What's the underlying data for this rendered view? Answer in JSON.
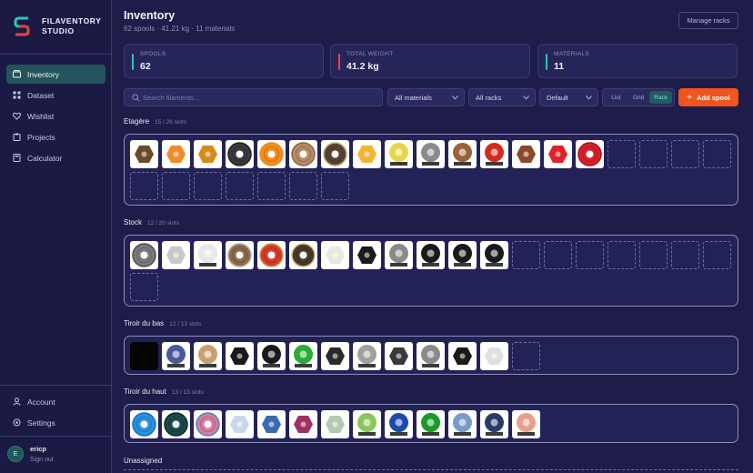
{
  "brand": {
    "line1": "FILAVENTORY",
    "line2": "STUDIO",
    "logo_icon": "filaventory-logo-icon"
  },
  "nav": [
    {
      "label": "Inventory",
      "icon": "box-icon",
      "active": true
    },
    {
      "label": "Dataset",
      "icon": "grid-icon",
      "active": false
    },
    {
      "label": "Wishlist",
      "icon": "heart-icon",
      "active": false
    },
    {
      "label": "Projects",
      "icon": "clipboard-icon",
      "active": false
    },
    {
      "label": "Calculator",
      "icon": "calculator-icon",
      "active": false
    }
  ],
  "nav_bottom": [
    {
      "label": "Account",
      "icon": "user-icon"
    },
    {
      "label": "Settings",
      "icon": "gear-icon"
    }
  ],
  "user": {
    "initial": "E",
    "name": "ericp",
    "sign_out": "Sign out"
  },
  "header": {
    "title": "Inventory",
    "subtitle": "62 spools · 41.21 kg · 11 materials",
    "manage_label": "Manage racks"
  },
  "stats": [
    {
      "label": "SPOOLS",
      "value": "62",
      "color": "#2ec4b6"
    },
    {
      "label": "TOTAL WEIGHT",
      "value": "41.2 kg",
      "color": "#e8453c"
    },
    {
      "label": "MATERIALS",
      "value": "11",
      "color": "#2ec4b6"
    }
  ],
  "toolbar": {
    "search_placeholder": "Search filaments...",
    "materials": "All materials",
    "racks": "All racks",
    "sort": "Default",
    "views": [
      "List",
      "Grid",
      "Rack"
    ],
    "active_view": "Rack",
    "add_label": "Add spool"
  },
  "racks": [
    {
      "name": "Etagère",
      "count": "15 / 26 slots",
      "spools": [
        {
          "kind": "sample",
          "color": "#6b4a2a"
        },
        {
          "kind": "sample",
          "color": "#f08a2a"
        },
        {
          "kind": "sample",
          "color": "#d98a1e"
        },
        {
          "kind": "spool",
          "color": "#3a3a3a",
          "ring": "#222222"
        },
        {
          "kind": "spool",
          "color": "#f28c1a",
          "ring": "#f28c1a"
        },
        {
          "kind": "spool",
          "color": "#b58a66",
          "ring": "#8a6a4a"
        },
        {
          "kind": "spool",
          "color": "#5a4330",
          "ring": "#c0b090"
        },
        {
          "kind": "sample",
          "color": "#f2b531"
        },
        {
          "kind": "bag",
          "color": "#e8d64a"
        },
        {
          "kind": "bag",
          "color": "#8a8a8a"
        },
        {
          "kind": "bag",
          "color": "#9a6238"
        },
        {
          "kind": "bag",
          "color": "#d42a1e"
        },
        {
          "kind": "sample",
          "color": "#8a4a2a"
        },
        {
          "kind": "sample",
          "color": "#e0202a"
        },
        {
          "kind": "spool",
          "color": "#d8202a",
          "ring": "#b0101a"
        }
      ],
      "empty": 11
    },
    {
      "name": "Stock",
      "count": "12 / 20 slots",
      "spools": [
        {
          "kind": "spool",
          "color": "#7a7a7a",
          "ring": "#505050"
        },
        {
          "kind": "sample",
          "color": "#c8c8c8"
        },
        {
          "kind": "bag",
          "color": "#e8e8e8"
        },
        {
          "kind": "spool",
          "color": "#8a6a4a",
          "ring": "#b0b0b0"
        },
        {
          "kind": "spool",
          "color": "#d83a2a",
          "ring": "#c0a060"
        },
        {
          "kind": "spool",
          "color": "#4a3a2a",
          "ring": "#d0c090"
        },
        {
          "kind": "sample",
          "color": "#e8e8e0"
        },
        {
          "kind": "sample",
          "color": "#1a1a1a"
        },
        {
          "kind": "bag",
          "color": "#8a8a8a"
        },
        {
          "kind": "bag",
          "color": "#1a1a1a"
        },
        {
          "kind": "bag",
          "color": "#1a1a1a"
        },
        {
          "kind": "bag",
          "color": "#1a1a1a"
        }
      ],
      "empty": 8
    },
    {
      "name": "Tiroir du bas",
      "count": "12 / 13 slots",
      "spools": [
        {
          "kind": "solid",
          "color": "#050505"
        },
        {
          "kind": "bag",
          "color": "#4a5a9a"
        },
        {
          "kind": "bag",
          "color": "#c8a070"
        },
        {
          "kind": "sample",
          "color": "#1a1a1a"
        },
        {
          "kind": "bag",
          "color": "#1a1a1a"
        },
        {
          "kind": "bag",
          "color": "#2aaa3a"
        },
        {
          "kind": "sample",
          "color": "#2a2a2a"
        },
        {
          "kind": "bag",
          "color": "#a0a0a0"
        },
        {
          "kind": "sample",
          "color": "#3a3a3a"
        },
        {
          "kind": "bag",
          "color": "#8a8a8a"
        },
        {
          "kind": "sample",
          "color": "#1a1a1a"
        },
        {
          "kind": "sample",
          "color": "#e0e0e0"
        }
      ],
      "empty": 1
    },
    {
      "name": "Tiroir du haut",
      "count": "13 / 13 slots",
      "spools": [
        {
          "kind": "spool",
          "color": "#2a90e0",
          "ring": "#1a70c0"
        },
        {
          "kind": "spool",
          "color": "#1a4a4a",
          "ring": "#0a2a2a"
        },
        {
          "kind": "spool",
          "color": "#d87aa0",
          "ring": "#4a8ad0"
        },
        {
          "kind": "sample",
          "color": "#c8d8e8"
        },
        {
          "kind": "sample",
          "color": "#3a6ab0"
        },
        {
          "kind": "sample",
          "color": "#a03060"
        },
        {
          "kind": "sample",
          "color": "#b8c8b8"
        },
        {
          "kind": "bag",
          "color": "#8ac85a"
        },
        {
          "kind": "bag",
          "color": "#1a4ab0"
        },
        {
          "kind": "bag",
          "color": "#1a9a2a"
        },
        {
          "kind": "bag",
          "color": "#7a9ac8"
        },
        {
          "kind": "bag",
          "color": "#2a3a6a"
        },
        {
          "kind": "bag",
          "color": "#e8a08a"
        }
      ],
      "empty": 0
    }
  ],
  "unassigned": {
    "title": "Unassigned"
  }
}
